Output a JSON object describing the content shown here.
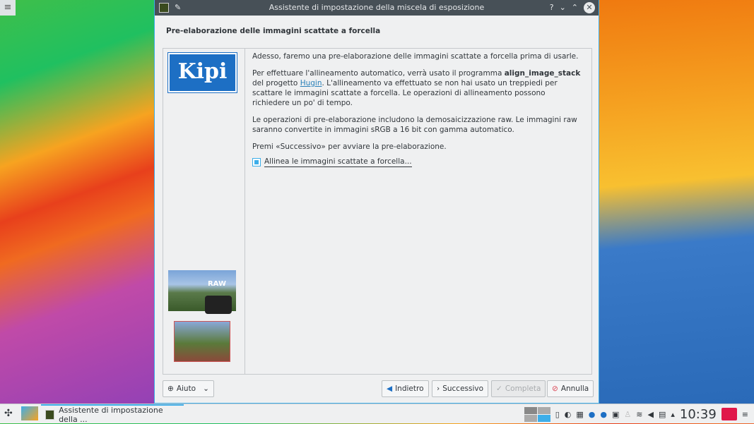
{
  "window": {
    "title": "Assistente di impostazione della miscela di esposizione",
    "help": "?",
    "minimize": "⌄",
    "maximize": "⌃",
    "close": "✕"
  },
  "page": {
    "title": "Pre-elaborazione delle immagini scattate a forcella",
    "p1": "Adesso, faremo una pre-elaborazione delle immagini scattate a forcella prima di usarle.",
    "p2a": "Per effettuare l'allineamento automatico, verrà usato il programma ",
    "p2b": "align_image_stack",
    "p2c": " del progetto ",
    "p2link": "Hugin",
    "p2d": ". L'allineamento va effettuato se non hai usato un treppiedi per scattare le immagini scattate a forcella. Le operazioni di allineamento possono richiedere un po' di tempo.",
    "p3": "Le operazioni di pre-elaborazione includono la demosaicizzazione raw. Le immagini raw saranno convertite in immagini sRGB a 16 bit con gamma automatico.",
    "p4": "Premi «Successivo» per avviare la pre-elaborazione.",
    "checkbox": "Allinea le immagini scattate a forcella...",
    "checked": true,
    "logo": "Kipi",
    "raw_label": "RAW"
  },
  "buttons": {
    "help": "Aiuto",
    "back": "Indietro",
    "next": "Successivo",
    "finish": "Completa",
    "cancel": "Annulla"
  },
  "taskbar": {
    "task": "Assistente di impostazione della ...",
    "clock": "10:39"
  }
}
